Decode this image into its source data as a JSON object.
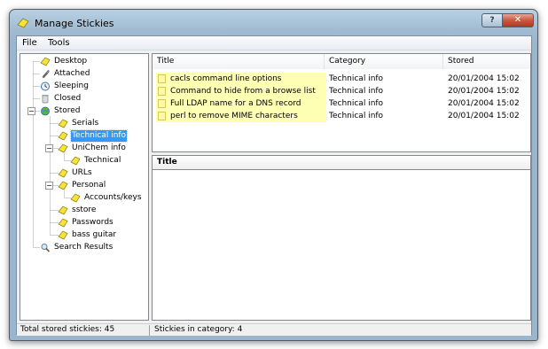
{
  "window": {
    "title": "Manage Stickies",
    "help_label": "?",
    "close_label": "✕"
  },
  "menu": {
    "items": [
      "File",
      "Tools"
    ]
  },
  "tree": {
    "items": [
      {
        "label": "Desktop",
        "icon": "sticky-note-icon"
      },
      {
        "label": "Attached",
        "icon": "paperclip-icon"
      },
      {
        "label": "Sleeping",
        "icon": "clock-icon"
      },
      {
        "label": "Closed",
        "icon": "trash-icon"
      },
      {
        "label": "Stored",
        "icon": "globe-icon",
        "expand": "−"
      },
      {
        "label": "Serials",
        "icon": "sticky-note-icon"
      },
      {
        "label": "Technical info",
        "icon": "sticky-note-icon",
        "selected": true
      },
      {
        "label": "UniChem info",
        "icon": "sticky-note-icon",
        "expand": "−"
      },
      {
        "label": "Technical",
        "icon": "sticky-note-icon"
      },
      {
        "label": "URLs",
        "icon": "sticky-note-icon"
      },
      {
        "label": "Personal",
        "icon": "sticky-note-icon",
        "expand": "−"
      },
      {
        "label": "Accounts/keys",
        "icon": "sticky-note-icon"
      },
      {
        "label": "sstore",
        "icon": "sticky-note-icon"
      },
      {
        "label": "Passwords",
        "icon": "sticky-note-icon"
      },
      {
        "label": "bass guitar",
        "icon": "sticky-note-icon"
      },
      {
        "label": "Search Results",
        "icon": "magnifier-icon"
      }
    ]
  },
  "list": {
    "columns": [
      "Title",
      "Category",
      "Stored"
    ],
    "rows": [
      {
        "title": "cacls command line options",
        "category": "Technical info",
        "stored": "20/01/2004 15:02"
      },
      {
        "title": "Command to hide from a browse list",
        "category": "Technical info",
        "stored": "20/01/2004 15:02"
      },
      {
        "title": "Full LDAP name for a DNS record",
        "category": "Technical info",
        "stored": "20/01/2004 15:02"
      },
      {
        "title": "perl to remove MIME characters",
        "category": "Technical info",
        "stored": "20/01/2004 15:02"
      }
    ]
  },
  "detail": {
    "header": "Title",
    "body": ""
  },
  "status": {
    "left": "Total stored stickies: 45",
    "right": "Stickies in category: 4"
  },
  "colors": {
    "selection": "#3399ff",
    "sticky_yellow": "#ffffb4",
    "close_red": "#c75a40"
  }
}
